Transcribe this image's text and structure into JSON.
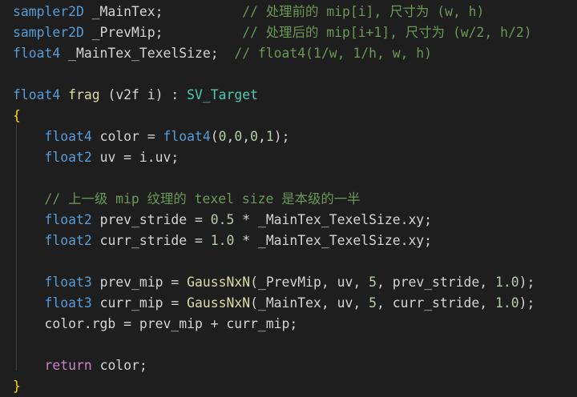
{
  "code": {
    "lines": [
      [
        {
          "t": "sampler2D",
          "k": "kw"
        },
        {
          "t": " _MainTex;          ",
          "k": ""
        },
        {
          "t": "// 处理前的 mip[i], 尺寸为 (w, h)",
          "k": "cm"
        }
      ],
      [
        {
          "t": "sampler2D",
          "k": "kw"
        },
        {
          "t": " _PrevMip;          ",
          "k": ""
        },
        {
          "t": "// 处理后的 mip[i+1], 尺寸为 (w/2, h/2)",
          "k": "cm"
        }
      ],
      [
        {
          "t": "float4",
          "k": "kw"
        },
        {
          "t": " _MainTex_TexelSize;  ",
          "k": ""
        },
        {
          "t": "// float4(1/w, 1/h, w, h)",
          "k": "cm"
        }
      ],
      [],
      [
        {
          "t": "float4",
          "k": "kw"
        },
        {
          "t": " ",
          "k": ""
        },
        {
          "t": "frag",
          "k": "fn"
        },
        {
          "t": " (v2f i) : ",
          "k": ""
        },
        {
          "t": "SV_Target",
          "k": "sem"
        }
      ],
      [
        {
          "t": "{",
          "k": "brace"
        }
      ],
      [
        {
          "t": "    ",
          "k": ""
        },
        {
          "t": "float4",
          "k": "kw"
        },
        {
          "t": " color = ",
          "k": ""
        },
        {
          "t": "float4",
          "k": "kw"
        },
        {
          "t": "(",
          "k": ""
        },
        {
          "t": "0",
          "k": "num"
        },
        {
          "t": ",",
          "k": ""
        },
        {
          "t": "0",
          "k": "num"
        },
        {
          "t": ",",
          "k": ""
        },
        {
          "t": "0",
          "k": "num"
        },
        {
          "t": ",",
          "k": ""
        },
        {
          "t": "1",
          "k": "num"
        },
        {
          "t": ");",
          "k": ""
        }
      ],
      [
        {
          "t": "    ",
          "k": ""
        },
        {
          "t": "float2",
          "k": "kw"
        },
        {
          "t": " uv = i.uv;",
          "k": ""
        }
      ],
      [],
      [
        {
          "t": "    ",
          "k": ""
        },
        {
          "t": "// 上一级 mip 纹理的 texel size 是本级的一半",
          "k": "cm"
        }
      ],
      [
        {
          "t": "    ",
          "k": ""
        },
        {
          "t": "float2",
          "k": "kw"
        },
        {
          "t": " prev_stride = ",
          "k": ""
        },
        {
          "t": "0.5",
          "k": "num"
        },
        {
          "t": " * _MainTex_TexelSize.xy;",
          "k": ""
        }
      ],
      [
        {
          "t": "    ",
          "k": ""
        },
        {
          "t": "float2",
          "k": "kw"
        },
        {
          "t": " curr_stride = ",
          "k": ""
        },
        {
          "t": "1.0",
          "k": "num"
        },
        {
          "t": " * _MainTex_TexelSize.xy;",
          "k": ""
        }
      ],
      [],
      [
        {
          "t": "    ",
          "k": ""
        },
        {
          "t": "float3",
          "k": "kw"
        },
        {
          "t": " prev_mip = ",
          "k": ""
        },
        {
          "t": "GaussNxN",
          "k": "fn"
        },
        {
          "t": "(_PrevMip, uv, ",
          "k": ""
        },
        {
          "t": "5",
          "k": "num"
        },
        {
          "t": ", prev_stride, ",
          "k": ""
        },
        {
          "t": "1.0",
          "k": "num"
        },
        {
          "t": ");",
          "k": ""
        }
      ],
      [
        {
          "t": "    ",
          "k": ""
        },
        {
          "t": "float3",
          "k": "kw"
        },
        {
          "t": " curr_mip = ",
          "k": ""
        },
        {
          "t": "GaussNxN",
          "k": "fn"
        },
        {
          "t": "(_MainTex, uv, ",
          "k": ""
        },
        {
          "t": "5",
          "k": "num"
        },
        {
          "t": ", curr_stride, ",
          "k": ""
        },
        {
          "t": "1.0",
          "k": "num"
        },
        {
          "t": ");",
          "k": ""
        }
      ],
      [
        {
          "t": "    color.rgb = prev_mip + curr_mip;",
          "k": ""
        }
      ],
      [],
      [
        {
          "t": "    ",
          "k": ""
        },
        {
          "t": "return",
          "k": "ret"
        },
        {
          "t": " color;",
          "k": ""
        }
      ],
      [
        {
          "t": "}",
          "k": "brace"
        }
      ]
    ]
  }
}
